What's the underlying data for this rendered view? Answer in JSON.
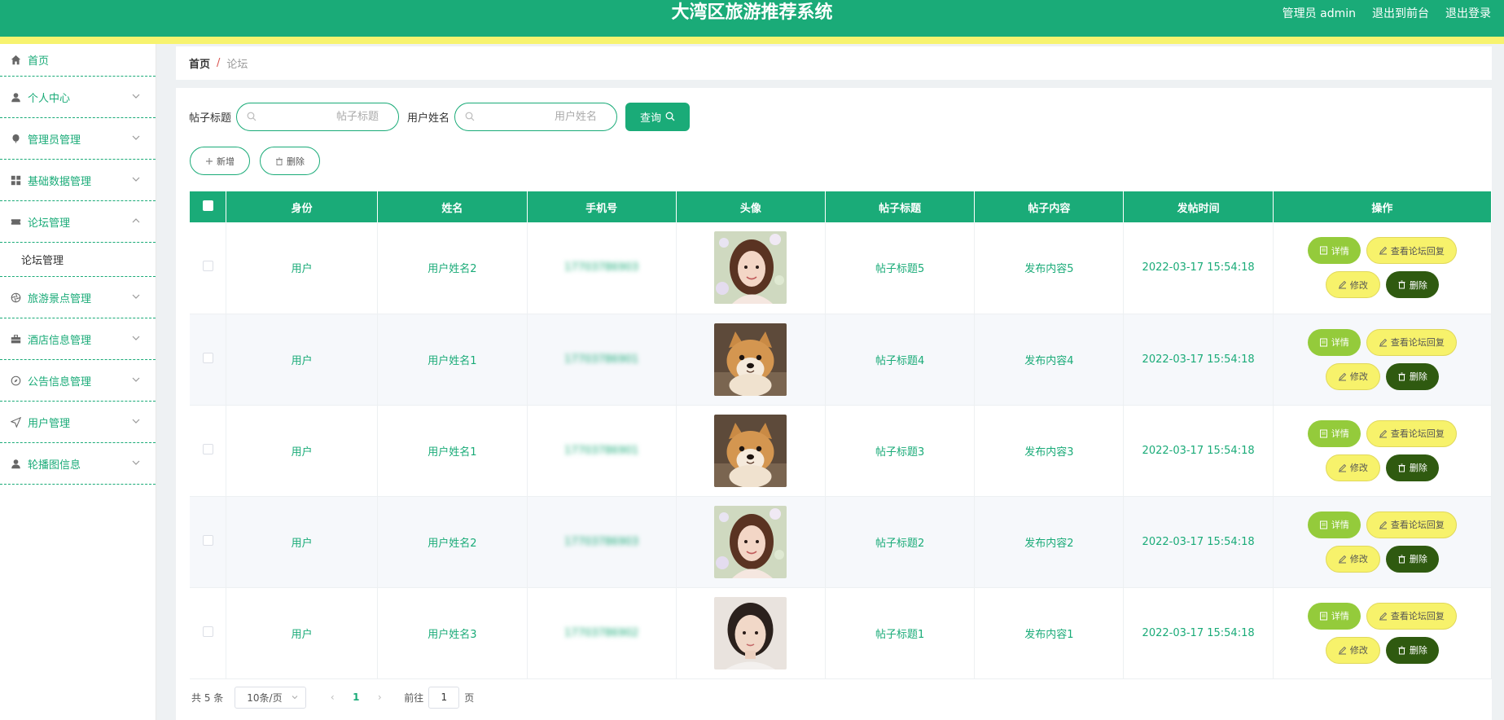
{
  "header": {
    "title": "大湾区旅游推荐系统",
    "admin": "管理员 admin",
    "front_link": "退出到前台",
    "logout": "退出登录"
  },
  "sidebar": {
    "items": [
      {
        "label": "首页",
        "icon": "home-icon"
      },
      {
        "label": "个人中心",
        "icon": "user-icon"
      },
      {
        "label": "管理员管理",
        "icon": "balloon-icon"
      },
      {
        "label": "基础数据管理",
        "icon": "grid-icon"
      },
      {
        "label": "论坛管理",
        "icon": "ticket-icon",
        "expanded": true
      },
      {
        "label": "旅游景点管理",
        "icon": "aperture-icon"
      },
      {
        "label": "酒店信息管理",
        "icon": "briefcase-icon"
      },
      {
        "label": "公告信息管理",
        "icon": "compass-icon"
      },
      {
        "label": "用户管理",
        "icon": "send-icon"
      },
      {
        "label": "轮播图信息",
        "icon": "person-icon"
      }
    ],
    "submenu": "论坛管理"
  },
  "breadcrumb": {
    "home": "首页",
    "separator": "/",
    "current": "论坛"
  },
  "search": {
    "title_label": "帖子标题",
    "title_placeholder": "帖子标题",
    "name_label": "用户姓名",
    "name_placeholder": "用户姓名",
    "query_button": "查询"
  },
  "actions": {
    "add": "新增",
    "delete": "删除"
  },
  "table": {
    "headers": [
      "身份",
      "姓名",
      "手机号",
      "头像",
      "帖子标题",
      "帖子内容",
      "发帖时间",
      "操作"
    ],
    "rows": [
      {
        "role": "用户",
        "name": "用户姓名2",
        "phone": "17703786903",
        "avatar": "woman-1",
        "title": "帖子标题5",
        "content": "发布内容5",
        "time": "2022-03-17 15:54:18"
      },
      {
        "role": "用户",
        "name": "用户姓名1",
        "phone": "17703786901",
        "avatar": "dog",
        "title": "帖子标题4",
        "content": "发布内容4",
        "time": "2022-03-17 15:54:18"
      },
      {
        "role": "用户",
        "name": "用户姓名1",
        "phone": "17703786901",
        "avatar": "dog",
        "title": "帖子标题3",
        "content": "发布内容3",
        "time": "2022-03-17 15:54:18"
      },
      {
        "role": "用户",
        "name": "用户姓名2",
        "phone": "17703786903",
        "avatar": "woman-1",
        "title": "帖子标题2",
        "content": "发布内容2",
        "time": "2022-03-17 15:54:18"
      },
      {
        "role": "用户",
        "name": "用户姓名3",
        "phone": "17703786902",
        "avatar": "woman-2",
        "title": "帖子标题1",
        "content": "发布内容1",
        "time": "2022-03-17 15:54:18"
      }
    ],
    "ops": {
      "detail": "详情",
      "reply": "查看论坛回复",
      "edit": "修改",
      "delete": "删除"
    }
  },
  "pagination": {
    "total": "共 5 条",
    "page_size": "10条/页",
    "current_page": "1",
    "goto_label": "前往",
    "goto_value": "1",
    "page_suffix": "页"
  },
  "colors": {
    "primary": "#1aab78",
    "accent_bar": "#f7f36f",
    "detail": "#94cb3b",
    "yellow": "#f7f26b",
    "delete": "#2f5a10"
  }
}
